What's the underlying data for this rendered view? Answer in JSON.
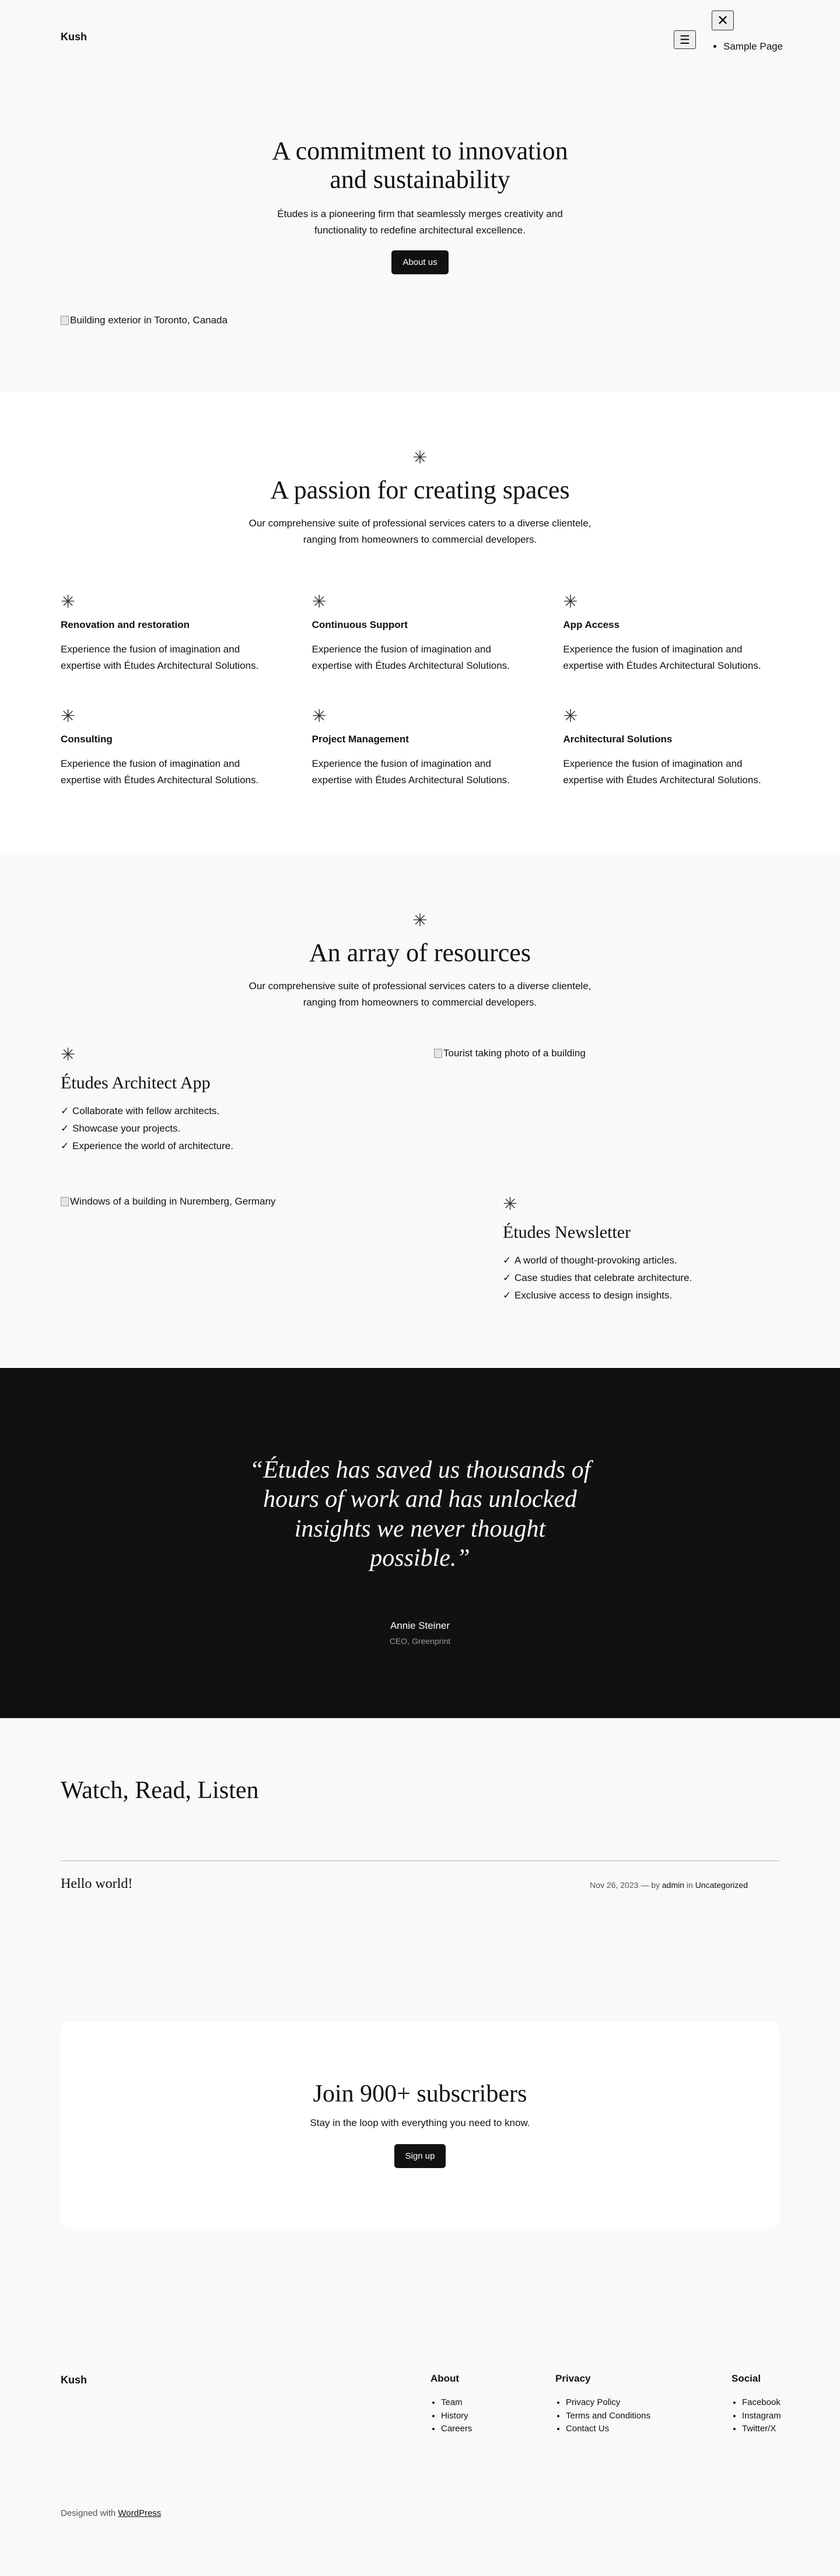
{
  "header": {
    "site_title": "Kush",
    "menu_items": [
      "Sample Page"
    ]
  },
  "hero": {
    "title": "A commitment to innovation and sustainability",
    "text": "Études is a pioneering firm that seamlessly merges creativity and functionality to redefine architectural excellence.",
    "button": "About us",
    "image_alt": "Building exterior in Toronto, Canada"
  },
  "passion": {
    "icon": "asterisk-icon",
    "title": "A passion for creating spaces",
    "subtitle": "Our comprehensive suite of professional services caters to a diverse clientele, ranging from homeowners to commercial developers.",
    "features": [
      {
        "title": "Renovation and restoration",
        "text": "Experience the fusion of imagination and expertise with Études Architectural Solutions."
      },
      {
        "title": "Continuous Support",
        "text": "Experience the fusion of imagination and expertise with Études Architectural Solutions."
      },
      {
        "title": "App Access",
        "text": "Experience the fusion of imagination and expertise with Études Architectural Solutions."
      },
      {
        "title": "Consulting",
        "text": "Experience the fusion of imagination and expertise with Études Architectural Solutions."
      },
      {
        "title": "Project Management",
        "text": "Experience the fusion of imagination and expertise with Études Architectural Solutions."
      },
      {
        "title": "Architectural Solutions",
        "text": "Experience the fusion of imagination and expertise with Études Architectural Solutions."
      }
    ]
  },
  "resources": {
    "title": "An array of resources",
    "subtitle": "Our comprehensive suite of professional services caters to a diverse clientele, ranging from homeowners to commercial developers.",
    "app": {
      "title": "Études Architect App",
      "items": [
        "Collaborate with fellow architects.",
        "Showcase your projects.",
        "Experience the world of architecture."
      ],
      "image_alt": "Tourist taking photo of a building"
    },
    "newsletter": {
      "title": "Études Newsletter",
      "items": [
        "A world of thought-provoking articles.",
        "Case studies that celebrate architecture.",
        "Exclusive access to design insights."
      ],
      "image_alt": "Windows of a building in Nuremberg, Germany"
    }
  },
  "testimonial": {
    "quote": "“Études has saved us thousands of hours of work and has unlocked insights we never thought possible.”",
    "name": "Annie Steiner",
    "role": "CEO, Greenprint"
  },
  "posts": {
    "title": "Watch, Read, Listen",
    "items": [
      {
        "title": "Hello world!",
        "date": "Nov 26, 2023",
        "by": "— by",
        "author": "admin",
        "in": "in",
        "category": "Uncategorized"
      }
    ]
  },
  "subscribe": {
    "title": "Join 900+ subscribers",
    "text": "Stay in the loop with everything you need to know.",
    "button": "Sign up"
  },
  "footer": {
    "site_title": "Kush",
    "columns": [
      {
        "heading": "About",
        "links": [
          "Team",
          "History",
          "Careers"
        ]
      },
      {
        "heading": "Privacy",
        "links": [
          "Privacy Policy",
          "Terms and Conditions",
          "Contact Us"
        ]
      },
      {
        "heading": "Social",
        "links": [
          "Facebook",
          "Instagram",
          "Twitter/X"
        ]
      }
    ],
    "credits_prefix": "Designed with",
    "credits_link": "WordPress"
  }
}
